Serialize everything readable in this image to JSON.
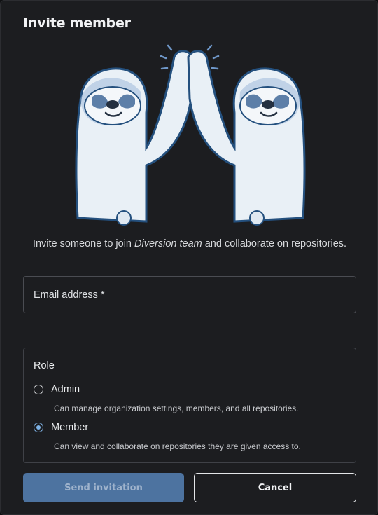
{
  "dialog": {
    "title": "Invite member",
    "intro_prefix": "Invite someone to join ",
    "team_name": "Diversion team",
    "intro_suffix": " and collaborate on repositories.",
    "illustration_icon": "high-five-sloths-illustration"
  },
  "email": {
    "label": "Email address *",
    "value": ""
  },
  "role": {
    "title": "Role",
    "options": [
      {
        "label": "Admin",
        "description": "Can manage organization settings, members, and all repositories.",
        "selected": false
      },
      {
        "label": "Member",
        "description": "Can view and collaborate on repositories they are given access to.",
        "selected": true
      }
    ]
  },
  "actions": {
    "send_label": "Send invitation",
    "cancel_label": "Cancel"
  },
  "colors": {
    "accent": "#7fb4e8",
    "primary_button": "#4d73a0",
    "background": "#1c1d20"
  }
}
